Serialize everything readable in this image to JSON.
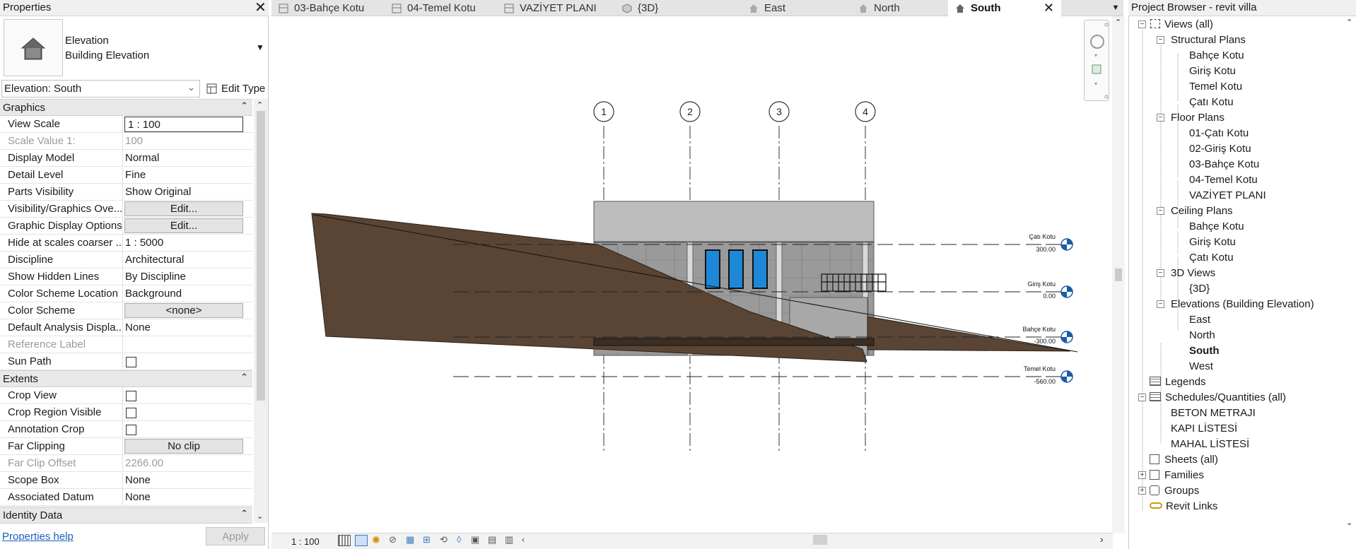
{
  "properties": {
    "title": "Properties",
    "type_line1": "Elevation",
    "type_line2": "Building Elevation",
    "selector": "Elevation: South",
    "edit_type": "Edit Type",
    "help": "Properties help",
    "apply": "Apply",
    "sections": {
      "graphics": "Graphics",
      "extents": "Extents",
      "identity": "Identity Data"
    },
    "graphics_rows": [
      {
        "k": "View Scale",
        "v": "1 : 100"
      },
      {
        "k": "Scale Value    1:",
        "v": "100"
      },
      {
        "k": "Display Model",
        "v": "Normal"
      },
      {
        "k": "Detail Level",
        "v": "Fine"
      },
      {
        "k": "Parts Visibility",
        "v": "Show Original"
      },
      {
        "k": "Visibility/Graphics Ove...",
        "v": "Edit..."
      },
      {
        "k": "Graphic Display Options",
        "v": "Edit..."
      },
      {
        "k": "Hide at scales coarser ...",
        "v": "1 : 5000"
      },
      {
        "k": "Discipline",
        "v": "Architectural"
      },
      {
        "k": "Show Hidden Lines",
        "v": "By Discipline"
      },
      {
        "k": "Color Scheme Location",
        "v": "Background"
      },
      {
        "k": "Color Scheme",
        "v": "<none>"
      },
      {
        "k": "Default Analysis Displa...",
        "v": "None"
      },
      {
        "k": "Reference Label",
        "v": ""
      },
      {
        "k": "Sun Path",
        "v": ""
      }
    ],
    "extents_rows": [
      {
        "k": "Crop View",
        "v": ""
      },
      {
        "k": "Crop Region Visible",
        "v": ""
      },
      {
        "k": "Annotation Crop",
        "v": ""
      },
      {
        "k": "Far Clipping",
        "v": "No clip"
      },
      {
        "k": "Far Clip Offset",
        "v": "2266.00"
      },
      {
        "k": "Scope Box",
        "v": "None"
      },
      {
        "k": "Associated Datum",
        "v": "None"
      }
    ]
  },
  "tabs": [
    {
      "label": "03-Bahçe Kotu",
      "icon": "plan-view-icon"
    },
    {
      "label": "04-Temel Kotu",
      "icon": "plan-view-icon"
    },
    {
      "label": "VAZİYET PLANI",
      "icon": "plan-view-icon"
    },
    {
      "label": "{3D}",
      "icon": "3d-view-icon"
    },
    {
      "label": "East",
      "icon": "elevation-icon"
    },
    {
      "label": "North",
      "icon": "elevation-icon"
    },
    {
      "label": "South",
      "icon": "elevation-icon",
      "active": true
    }
  ],
  "canvas": {
    "grids": [
      "1",
      "2",
      "3",
      "4"
    ],
    "levels": [
      {
        "name": "Çatı Kotu",
        "elev": "300.00"
      },
      {
        "name": "Giriş Kotu",
        "elev": "0.00"
      },
      {
        "name": "Bahçe Kotu",
        "elev": "-300.00"
      },
      {
        "name": "Temel Kotu",
        "elev": "-560.00"
      }
    ],
    "scale": "1 : 100"
  },
  "browser": {
    "title": "Project Browser - revit villa",
    "views_all": "Views (all)",
    "structural_plans": "Structural Plans",
    "structural_items": [
      "Bahçe Kotu",
      "Giriş Kotu",
      "Temel Kotu",
      "Çatı Kotu"
    ],
    "floor_plans": "Floor Plans",
    "floor_items": [
      "01-Çatı Kotu",
      "02-Giriş Kotu",
      "03-Bahçe Kotu",
      "04-Temel Kotu",
      "VAZİYET PLANI"
    ],
    "ceiling_plans": "Ceiling Plans",
    "ceiling_items": [
      "Bahçe Kotu",
      "Giriş Kotu",
      "Çatı Kotu"
    ],
    "views_3d": "3D Views",
    "views_3d_items": [
      "{3D}"
    ],
    "elevations": "Elevations (Building Elevation)",
    "elevation_items": [
      "East",
      "North",
      "South",
      "West"
    ],
    "legends": "Legends",
    "schedules": "Schedules/Quantities (all)",
    "schedule_items": [
      "BETON METRAJI",
      "KAPI LİSTESİ",
      "MAHAL LİSTESİ"
    ],
    "sheets": "Sheets (all)",
    "families": "Families",
    "groups": "Groups",
    "links": "Revit Links"
  },
  "colors": {
    "terrain": "#5a4535",
    "glass": "#1e88d8",
    "building": "#bdbdbd"
  }
}
